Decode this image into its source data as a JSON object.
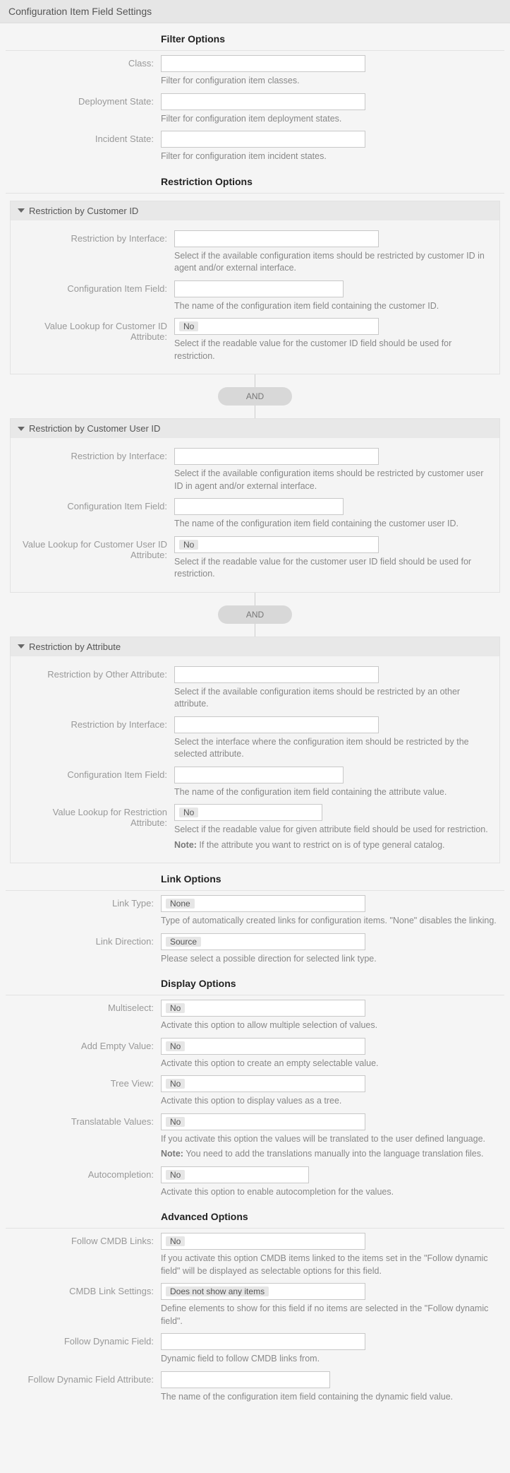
{
  "page_title": "Configuration Item Field Settings",
  "sections": {
    "filter": {
      "title": "Filter Options",
      "class_label": "Class:",
      "class_help": "Filter for configuration item classes.",
      "deploy_label": "Deployment State:",
      "deploy_help": "Filter for configuration item deployment states.",
      "incident_label": "Incident State:",
      "incident_help": "Filter for configuration item incident states."
    },
    "restriction": {
      "title": "Restriction Options",
      "connector": "AND",
      "customer_id": {
        "title": "Restriction by Customer ID",
        "iface_label": "Restriction by Interface:",
        "iface_help": "Select if the available configuration items should be restricted by customer ID in agent and/or external interface.",
        "field_label": "Configuration Item Field:",
        "field_help": "The name of the configuration item field containing the customer ID.",
        "lookup_label": "Value Lookup for Customer ID Attribute:",
        "lookup_value": "No",
        "lookup_help": "Select if the readable value for the customer ID field should be used for restriction."
      },
      "customer_user_id": {
        "title": "Restriction by Customer User ID",
        "iface_label": "Restriction by Interface:",
        "iface_help": "Select if the available configuration items should be restricted by customer user ID in agent and/or external interface.",
        "field_label": "Configuration Item Field:",
        "field_help": "The name of the configuration item field containing the customer user ID.",
        "lookup_label": "Value Lookup for Customer User ID Attribute:",
        "lookup_value": "No",
        "lookup_help": "Select if the readable value for the customer user ID field should be used for restriction."
      },
      "attribute": {
        "title": "Restriction by Attribute",
        "other_label": "Restriction by Other Attribute:",
        "other_help": "Select if the available configuration items should be restricted by an other attribute.",
        "iface_label": "Restriction by Interface:",
        "iface_help": "Select the interface where the configuration item should be restricted by the selected attribute.",
        "field_label": "Configuration Item Field:",
        "field_help": "The name of the configuration item field containing the attribute value.",
        "lookup_label": "Value Lookup for Restriction Attribute:",
        "lookup_value": "No",
        "lookup_help": "Select if the readable value for given attribute field should be used for restriction.",
        "lookup_note_prefix": "Note: ",
        "lookup_note": "If the attribute you want to restrict on is of type general catalog."
      }
    },
    "link": {
      "title": "Link Options",
      "type_label": "Link Type:",
      "type_value": "None",
      "type_help": "Type of automatically created links for configuration items. \"None\" disables the linking.",
      "dir_label": "Link Direction:",
      "dir_value": "Source",
      "dir_help": "Please select a possible direction for selected link type."
    },
    "display": {
      "title": "Display Options",
      "multi_label": "Multiselect:",
      "multi_value": "No",
      "multi_help": "Activate this option to allow multiple selection of values.",
      "empty_label": "Add Empty Value:",
      "empty_value": "No",
      "empty_help": "Activate this option to create an empty selectable value.",
      "tree_label": "Tree View:",
      "tree_value": "No",
      "tree_help": "Activate this option to display values as a tree.",
      "trans_label": "Translatable Values:",
      "trans_value": "No",
      "trans_help": "If you activate this option the values will be translated to the user defined language.",
      "trans_note_prefix": "Note: ",
      "trans_note": "You need to add the translations manually into the language translation files.",
      "auto_label": "Autocompletion:",
      "auto_value": "No",
      "auto_help": "Activate this option to enable autocompletion for the values."
    },
    "advanced": {
      "title": "Advanced Options",
      "follow_label": "Follow CMDB Links:",
      "follow_value": "No",
      "follow_help": "If you activate this option CMDB items linked to the items set in the \"Follow dynamic field\" will be displayed as selectable options for this field.",
      "linkset_label": "CMDB Link Settings:",
      "linkset_value": "Does not show any items",
      "linkset_help": "Define elements to show for this field if no items are selected in the \"Follow dynamic field\".",
      "dyn_label": "Follow Dynamic Field:",
      "dyn_help": "Dynamic field to follow CMDB links from.",
      "dynattr_label": "Follow Dynamic Field Attribute:",
      "dynattr_help": "The name of the configuration item field containing the dynamic field value."
    }
  }
}
